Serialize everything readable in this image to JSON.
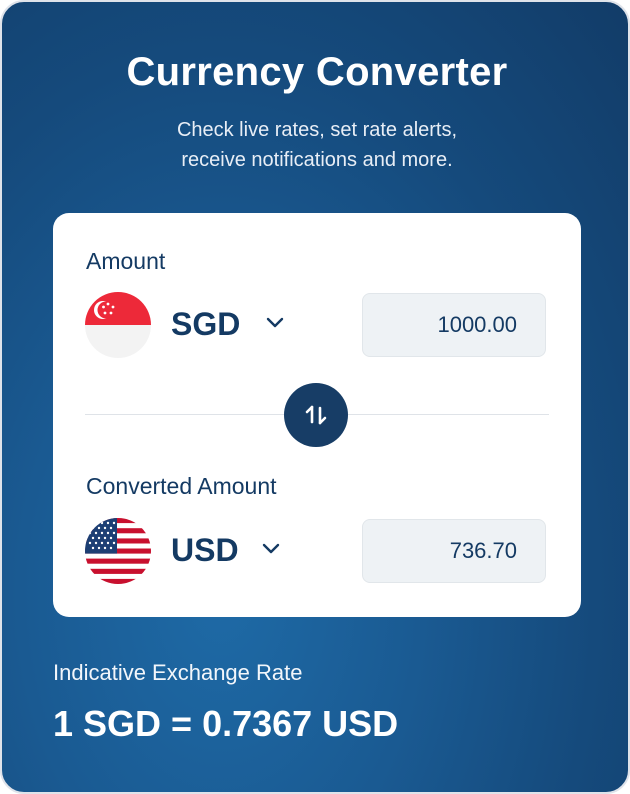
{
  "header": {
    "title": "Currency Converter",
    "subtitle_line1": "Check live rates, set rate alerts,",
    "subtitle_line2": "receive notifications and more."
  },
  "converter": {
    "from": {
      "label": "Amount",
      "currency": "SGD",
      "flag_icon": "singapore-flag-icon",
      "amount": "1000.00"
    },
    "to": {
      "label": "Converted Amount",
      "currency": "USD",
      "flag_icon": "usa-flag-icon",
      "amount": "736.70"
    },
    "swap_icon": "swap-arrows-icon"
  },
  "rate": {
    "label": "Indicative Exchange Rate",
    "value": "1 SGD = 0.7367 USD"
  },
  "colors": {
    "panel_gradient": [
      "#1e6aa6",
      "#123c68"
    ],
    "primary_dark": "#143a63",
    "card_bg": "#ffffff",
    "input_bg": "#eef2f5"
  }
}
